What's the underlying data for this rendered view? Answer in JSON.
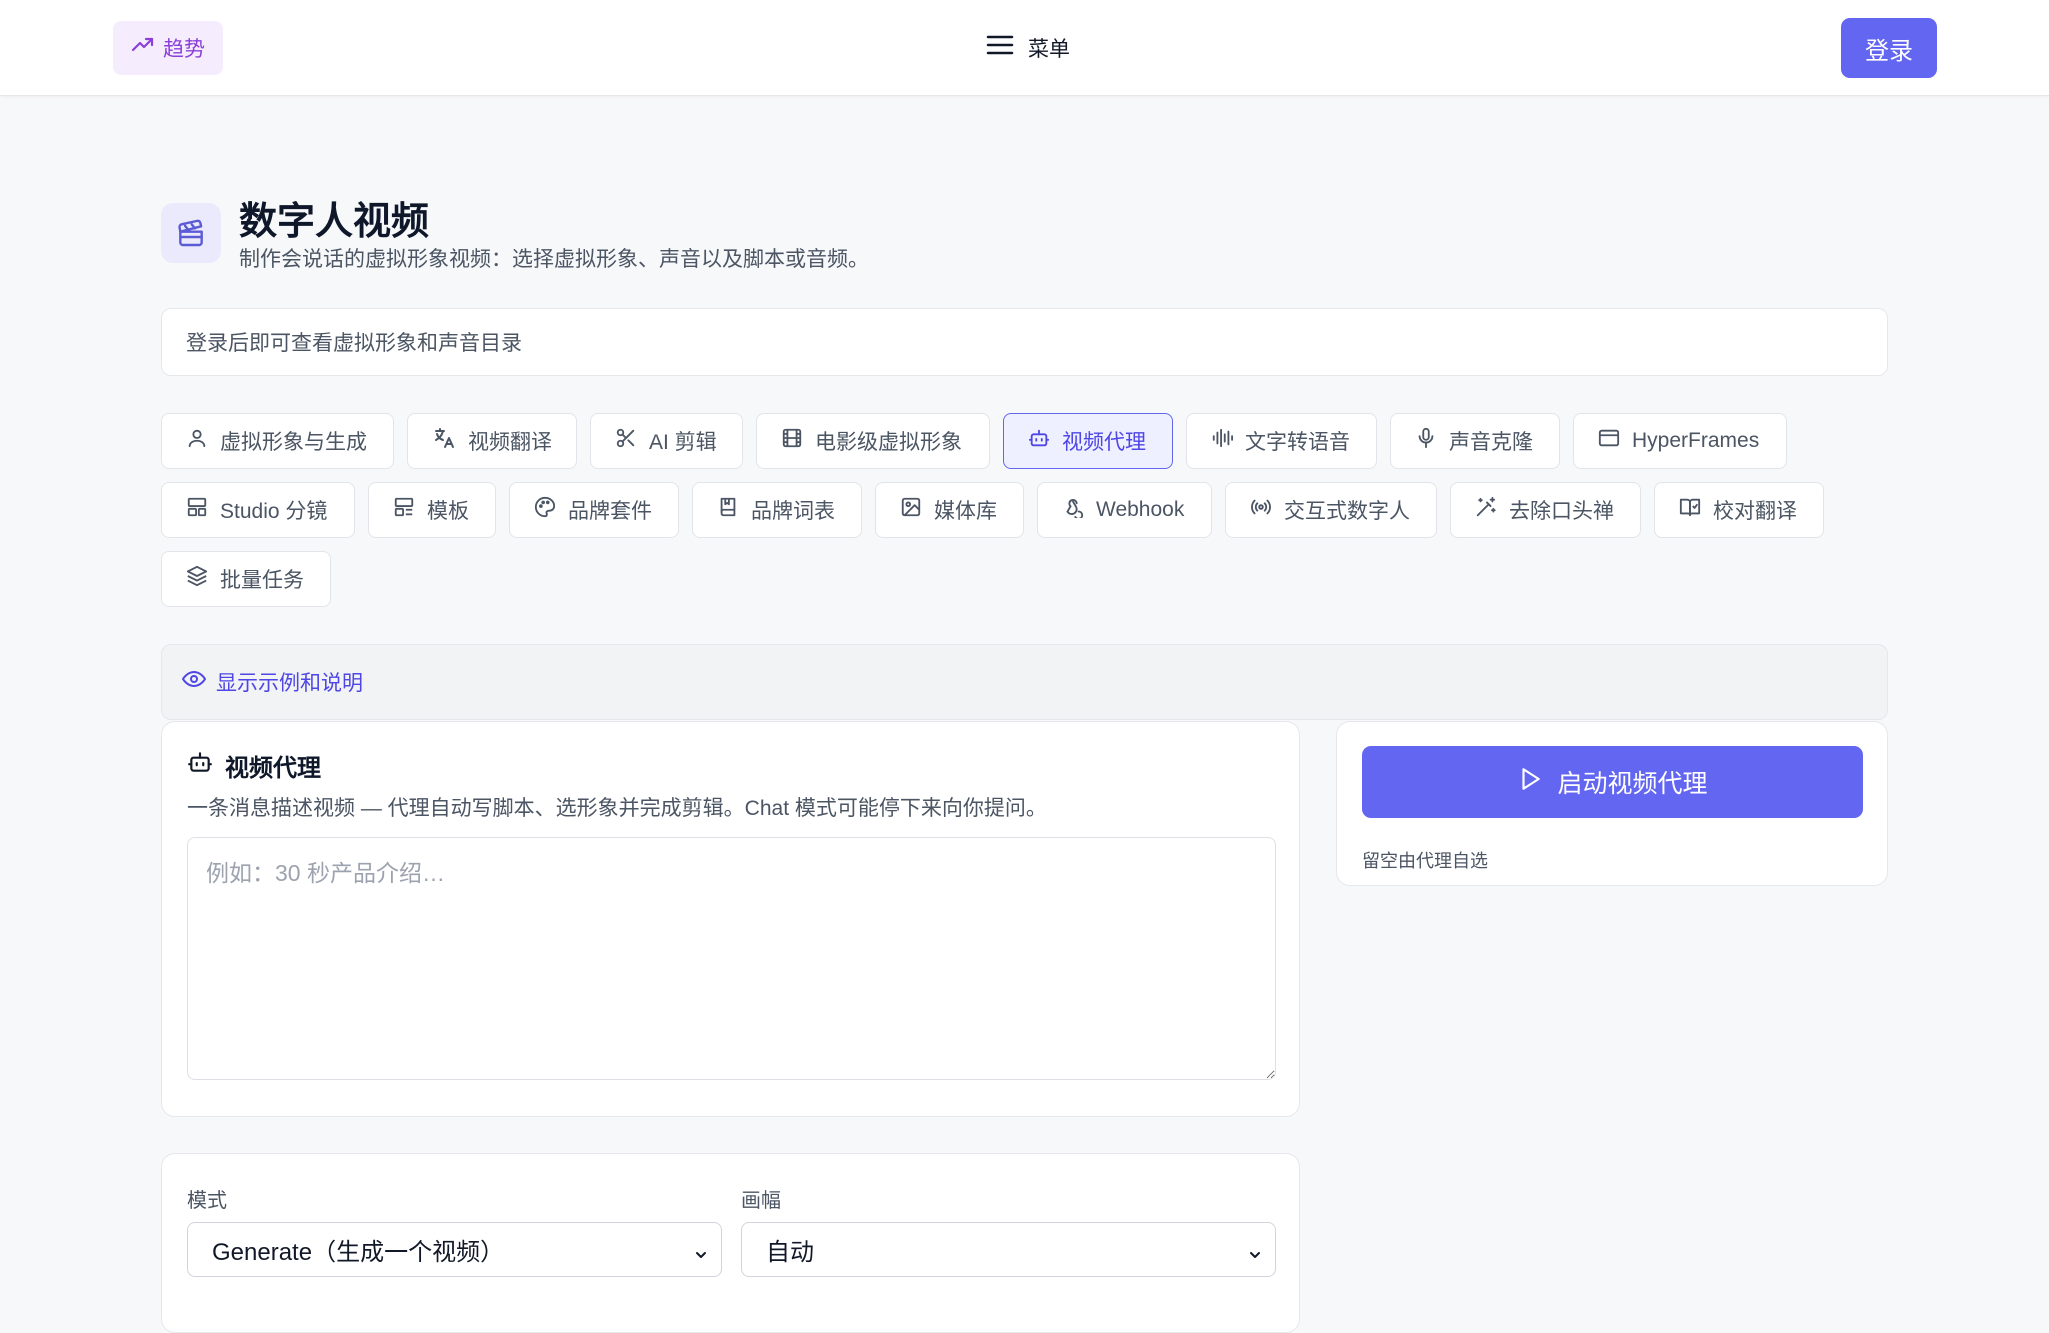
{
  "topbar": {
    "trend_label": "趋势",
    "menu_label": "菜单",
    "login_label": "登录"
  },
  "header": {
    "title": "数字人视频",
    "subtitle": "制作会说话的虚拟形象视频：选择虚拟形象、声音以及脚本或音频。"
  },
  "notice": "登录后即可查看虚拟形象和声音目录",
  "tabs": [
    {
      "label": "虚拟形象与生成",
      "icon": "user-icon",
      "active": false
    },
    {
      "label": "视频翻译",
      "icon": "translate-icon",
      "active": false
    },
    {
      "label": "AI 剪辑",
      "icon": "scissors-icon",
      "active": false
    },
    {
      "label": "电影级虚拟形象",
      "icon": "film-icon",
      "active": false
    },
    {
      "label": "视频代理",
      "icon": "bot-icon",
      "active": true
    },
    {
      "label": "文字转语音",
      "icon": "waveform-icon",
      "active": false
    },
    {
      "label": "声音克隆",
      "icon": "mic-icon",
      "active": false
    },
    {
      "label": "HyperFrames",
      "icon": "browser-window-icon",
      "active": false
    },
    {
      "label": "Studio 分镜",
      "icon": "layout-icon",
      "active": false
    },
    {
      "label": "模板",
      "icon": "template-icon",
      "active": false
    },
    {
      "label": "品牌套件",
      "icon": "palette-icon",
      "active": false
    },
    {
      "label": "品牌词表",
      "icon": "book-icon",
      "active": false
    },
    {
      "label": "媒体库",
      "icon": "image-icon",
      "active": false
    },
    {
      "label": "Webhook",
      "icon": "webhook-icon",
      "active": false
    },
    {
      "label": "交互式数字人",
      "icon": "radio-signal-icon",
      "active": false
    },
    {
      "label": "去除口头禅",
      "icon": "magic-wand-icon",
      "active": false
    },
    {
      "label": "校对翻译",
      "icon": "book-check-icon",
      "active": false
    },
    {
      "label": "批量任务",
      "icon": "layers-icon",
      "active": false
    }
  ],
  "examples_toggle": "显示示例和说明",
  "agent_card": {
    "title": "视频代理",
    "description": "一条消息描述视频 — 代理自动写脚本、选形象并完成剪辑。Chat 模式可能停下来向你提问。",
    "prompt_placeholder": "例如：30 秒产品介绍…",
    "prompt_value": ""
  },
  "side_card": {
    "start_label": "启动视频代理",
    "hint": "留空由代理自选"
  },
  "settings": {
    "mode_label": "模式",
    "mode_value": "Generate（生成一个视频）",
    "aspect_label": "画幅",
    "aspect_value": "自动"
  },
  "colors": {
    "accent": "#6366f1",
    "trend_purple": "#8b3fd9",
    "background": "#f7f8fa"
  }
}
